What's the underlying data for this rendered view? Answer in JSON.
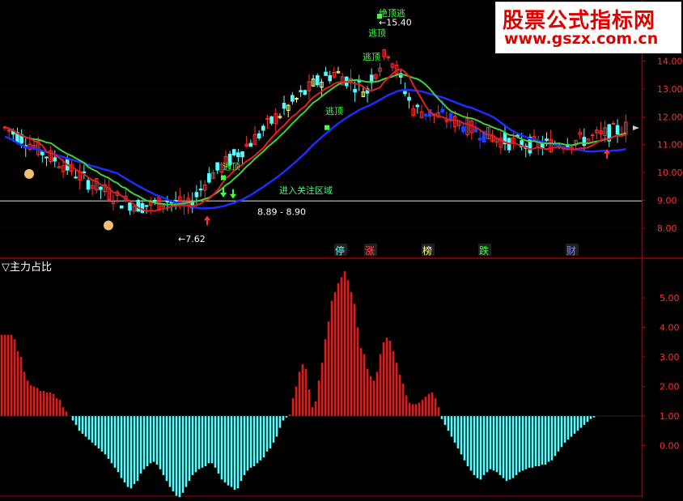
{
  "watermark": {
    "title": "股票公式指标网",
    "url": "www.gszx.com.cn"
  },
  "top_panel": {
    "price_ticks": [
      "14.00",
      "13.00",
      "12.00",
      "11.00",
      "10.00",
      "9.00",
      "8.00"
    ],
    "annotations": {
      "high_label": "15.40",
      "low_label": "7.62",
      "band_label": "8.89 - 8.90",
      "zone_label": "进入关注区域",
      "top_label": "绝顶逃",
      "escape_label": "逃顶"
    },
    "event_markers": [
      "停",
      "涨",
      "榜",
      "跌",
      "财"
    ]
  },
  "bottom_panel": {
    "indicator_title": "▽主力占比",
    "ticks": [
      "5.00",
      "4.00",
      "3.00",
      "2.00",
      "1.00",
      "0.00"
    ]
  },
  "colors": {
    "up": "#ff3030",
    "down": "#54ffff",
    "ma_blue": "#1e2cff",
    "ma_green": "#40d040",
    "ma_red": "#e02020",
    "axis": "#a00000",
    "hist_red": "#e01818",
    "hist_cyan": "#54ffff"
  },
  "chart_data": [
    {
      "type": "candlestick",
      "title": "",
      "ylim": [
        7.4,
        15.8
      ],
      "yticks": [
        8,
        9,
        10,
        11,
        12,
        13,
        14
      ],
      "high": 15.4,
      "low": 7.62,
      "price_band": [
        8.89,
        8.9
      ],
      "series": [
        {
          "name": "",
          "values": [
            11.6,
            11.2,
            10.7,
            10.3,
            9.8,
            9.4,
            9.0,
            8.8,
            8.9,
            9.2,
            9.6,
            10.1,
            10.7,
            11.3,
            12.0,
            12.6,
            13.2,
            13.6,
            13.2,
            12.8,
            12.5,
            12.3,
            12.1,
            11.9,
            11.6,
            11.3,
            11.1,
            11.0,
            11.0,
            11.1,
            11.2,
            11.4,
            11.6
          ]
        }
      ]
    },
    {
      "type": "bar",
      "title": "",
      "ylim": [
        -1.8,
        6.1
      ],
      "baseline": 1.0,
      "x": [
        1,
        2,
        3,
        4,
        5,
        6,
        7,
        8,
        9,
        10,
        11,
        12,
        13,
        14,
        15,
        16,
        17,
        18,
        19,
        20,
        21,
        22,
        23,
        24,
        25,
        26,
        27,
        28,
        29,
        30,
        31,
        32,
        33,
        34,
        35,
        36,
        37,
        38,
        39,
        40,
        41,
        42,
        43,
        44,
        45,
        46,
        47,
        48,
        49,
        50,
        51,
        52,
        53,
        54,
        55,
        56,
        57,
        58,
        59,
        60,
        61,
        62,
        63,
        64,
        65,
        66,
        67,
        68,
        69,
        70,
        71,
        72,
        73,
        74,
        75,
        76,
        77,
        78,
        79,
        80,
        81,
        82,
        83,
        84,
        85,
        86,
        87,
        88,
        89,
        90,
        91,
        92,
        93,
        94,
        95,
        96,
        97,
        98,
        99,
        100,
        101,
        102,
        103,
        104,
        105,
        106,
        107,
        108,
        109,
        110,
        111,
        112,
        113,
        114,
        115,
        116,
        117,
        118,
        119,
        120,
        121,
        122,
        123,
        124,
        125,
        126,
        127,
        128,
        129,
        130,
        131,
        132,
        133,
        134,
        135,
        136,
        137,
        138,
        139,
        140,
        141,
        142,
        143,
        144,
        145,
        146,
        147,
        148,
        149,
        150,
        151,
        152,
        153,
        154,
        155,
        156,
        157,
        158,
        159,
        160,
        161,
        162,
        163,
        164,
        165,
        166,
        167,
        168,
        169,
        170,
        171,
        172,
        173,
        174,
        175,
        176,
        177,
        178,
        179,
        180,
        181,
        182,
        183,
        184,
        185,
        186,
        187,
        188,
        189,
        190,
        191,
        192,
        193
      ],
      "values": [
        3.75,
        3.75,
        3.75,
        3.75,
        3.6,
        3.2,
        3.0,
        2.5,
        2.2,
        2.05,
        2.0,
        1.95,
        1.85,
        1.85,
        1.8,
        1.8,
        1.75,
        1.6,
        1.55,
        1.3,
        1.15,
        1.0,
        0.85,
        0.7,
        0.5,
        0.4,
        0.3,
        0.2,
        0.1,
        0.0,
        -0.1,
        -0.2,
        -0.3,
        -0.45,
        -0.6,
        -0.75,
        -0.9,
        -1.1,
        -1.25,
        -1.4,
        -1.45,
        -1.3,
        -1.2,
        -0.95,
        -0.8,
        -0.7,
        -0.6,
        -0.55,
        -0.65,
        -0.8,
        -1.0,
        -1.2,
        -1.4,
        -1.55,
        -1.7,
        -1.75,
        -1.6,
        -1.4,
        -1.2,
        -1.0,
        -0.9,
        -0.8,
        -0.75,
        -0.7,
        -0.6,
        -0.6,
        -0.75,
        -0.95,
        -1.15,
        -1.25,
        -1.35,
        -1.4,
        -1.5,
        -1.45,
        -1.2,
        -1.0,
        -0.85,
        -0.75,
        -0.7,
        -0.6,
        -0.5,
        -0.4,
        -0.2,
        -0.1,
        0.1,
        0.3,
        0.6,
        0.85,
        0.95,
        1.05,
        1.6,
        2.0,
        2.5,
        2.75,
        2.6,
        1.9,
        1.3,
        1.5,
        2.2,
        2.8,
        3.6,
        4.2,
        4.9,
        5.2,
        5.5,
        5.7,
        5.9,
        5.6,
        5.2,
        4.8,
        4.0,
        3.3,
        3.1,
        2.6,
        2.35,
        2.2,
        2.5,
        3.1,
        3.5,
        3.65,
        3.55,
        3.2,
        2.8,
        2.4,
        2.1,
        1.7,
        1.45,
        1.4,
        1.4,
        1.45,
        1.55,
        1.65,
        1.75,
        1.8,
        1.6,
        1.3,
        0.9,
        0.7,
        0.5,
        0.3,
        0.1,
        -0.1,
        -0.3,
        -0.5,
        -0.7,
        -0.85,
        -1.0,
        -1.1,
        -1.15,
        -1.0,
        -0.9,
        -0.8,
        -0.85,
        -0.9,
        -1.0,
        -1.1,
        -1.2,
        -1.15,
        -1.1,
        -1.0,
        -0.9,
        -0.85,
        -0.8,
        -0.75,
        -0.75,
        -0.7,
        -0.7,
        -0.65,
        -0.65,
        -0.55,
        -0.5,
        -0.35,
        -0.2,
        -0.05,
        0.1,
        0.2,
        0.3,
        0.4,
        0.5,
        0.6,
        0.7,
        0.8,
        0.9,
        0.95,
        1.0,
        1.0,
        1.0
      ]
    }
  ]
}
